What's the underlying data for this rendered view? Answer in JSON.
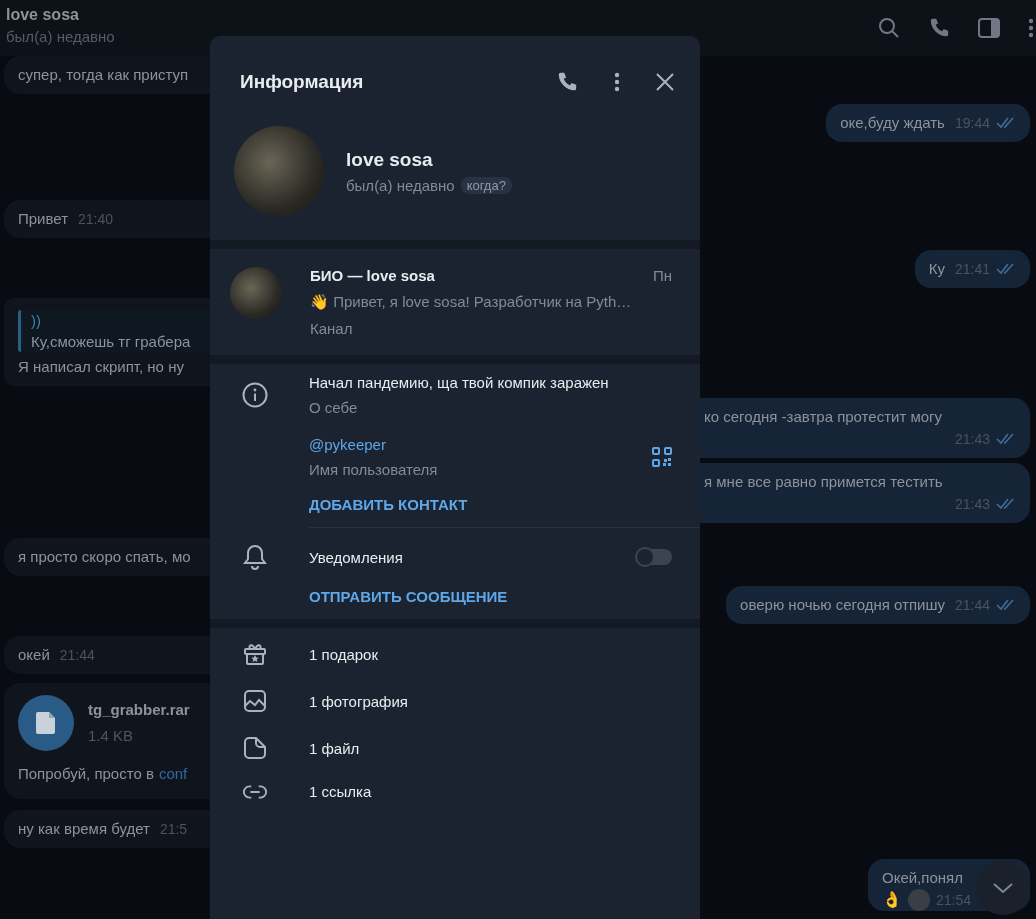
{
  "chat_header": {
    "name": "love sosa",
    "status": "был(а) недавно"
  },
  "messages": [
    {
      "kind": "text",
      "outgoing": false,
      "text": "супер, тогда как приступ"
    },
    {
      "kind": "text",
      "outgoing": true,
      "text": "оке,буду ждать",
      "time": "19:44",
      "read": true
    },
    {
      "kind": "text",
      "outgoing": false,
      "text": "Привет",
      "time": "21:40"
    },
    {
      "kind": "text",
      "outgoing": true,
      "text": "Ку",
      "time": "21:41",
      "read": true
    },
    {
      "kind": "reply",
      "outgoing": false,
      "quote_title": "))",
      "quote_text": "Ку,сможешь тг грабера",
      "text": "Я написал скрипт, но ну"
    },
    {
      "kind": "text",
      "outgoing": true,
      "wrap": true,
      "text": "ко сегодня -завтра протестит могу",
      "time": "21:43",
      "read": true
    },
    {
      "kind": "text",
      "outgoing": true,
      "wrap": true,
      "text": "я мне все равно примется тестить",
      "time": "21:43",
      "read": true
    },
    {
      "kind": "text",
      "outgoing": false,
      "text": "я просто скоро спать, мо"
    },
    {
      "kind": "text",
      "outgoing": true,
      "text": "оверю ночью сегодня отпишу",
      "time": "21:44",
      "read": true
    },
    {
      "kind": "text",
      "outgoing": false,
      "text": "окей",
      "time": "21:44"
    },
    {
      "kind": "file",
      "outgoing": false,
      "file_name": "tg_grabber.rar",
      "file_size": "1.4 KB",
      "text": "Попробуй, просто в",
      "link": "conf"
    },
    {
      "kind": "text",
      "outgoing": false,
      "text": "ну как время будет",
      "time": "21:5"
    },
    {
      "kind": "reaction",
      "outgoing": true,
      "text": "Окей,понял",
      "reaction": "👌",
      "time": "21:54"
    }
  ],
  "info_dialog": {
    "title": "Информация",
    "profile": {
      "name": "love sosa",
      "status": "был(а) недавно",
      "status_badge": "когда?"
    },
    "channel": {
      "title": "БИО — love sosa",
      "date": "Пн",
      "preview": "👋 Привет, я love sosa!  Разработчик на Pyth…",
      "label": "Канал"
    },
    "about": {
      "value": "Начал пандемию, ща твой компик заражен",
      "label": "О себе"
    },
    "username": {
      "value": "@pykeeper",
      "label": "Имя пользователя"
    },
    "add_contact_button": "ДОБАВИТЬ КОНТАКТ",
    "notifications": {
      "label": "Уведомления",
      "on": false
    },
    "send_message_button": "ОТПРАВИТЬ СООБЩЕНИЕ",
    "media": [
      {
        "kind": "gift",
        "label": "1 подарок"
      },
      {
        "kind": "photo",
        "label": "1 фотография"
      },
      {
        "kind": "file",
        "label": "1 файл"
      },
      {
        "kind": "link",
        "label": "1 ссылка"
      }
    ]
  }
}
